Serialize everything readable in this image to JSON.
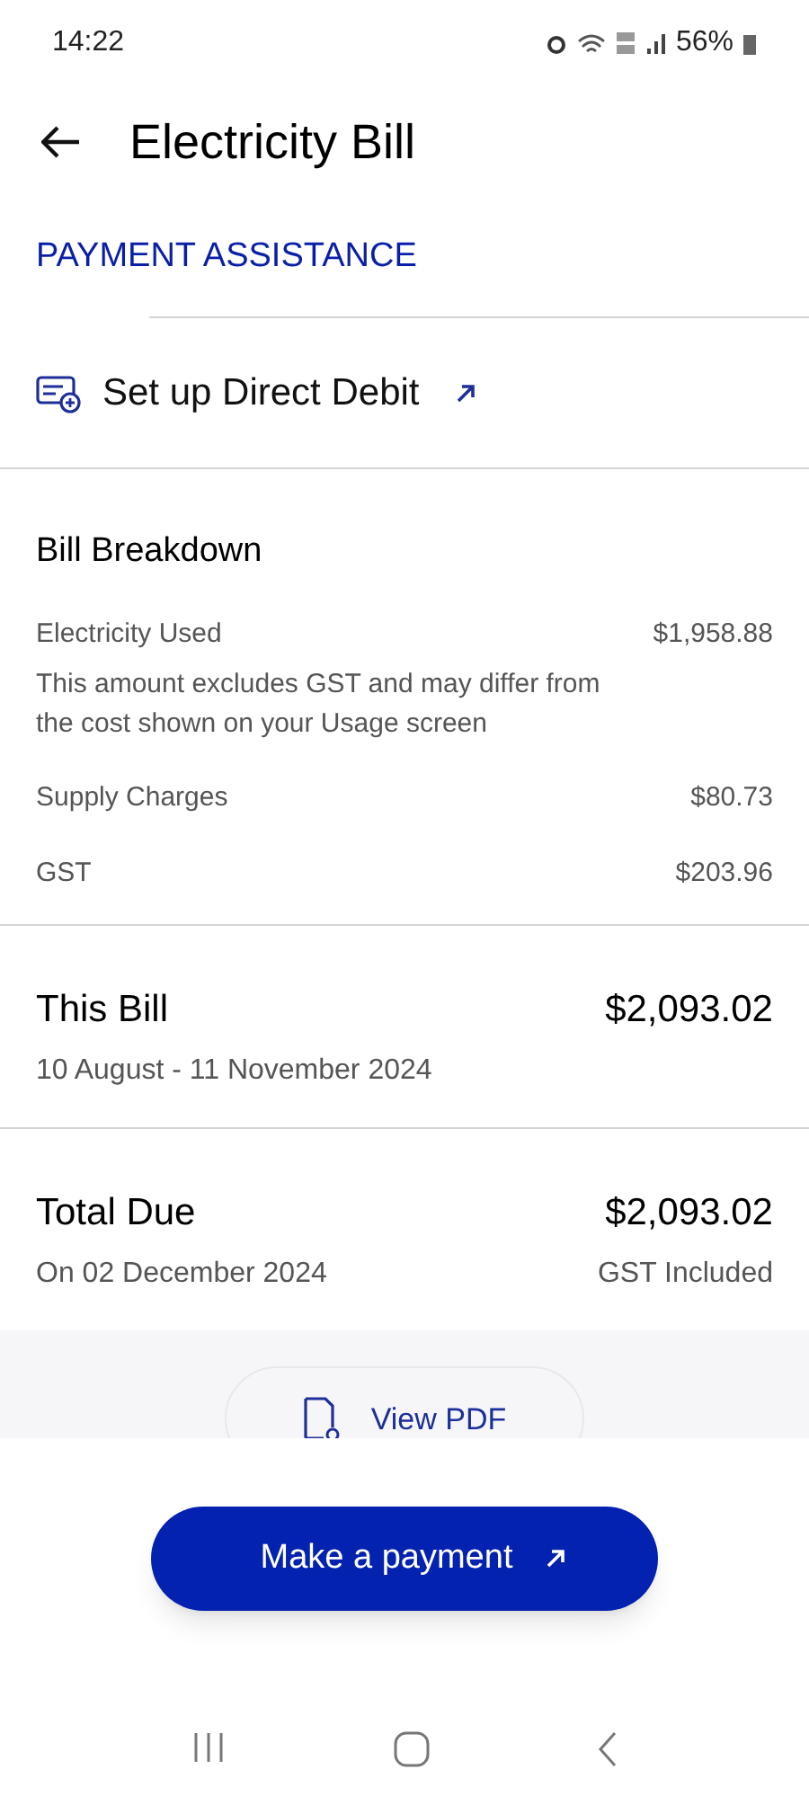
{
  "status_bar": {
    "time": "14:22",
    "battery": "56%"
  },
  "header": {
    "title": "Electricity Bill"
  },
  "payment_assistance": {
    "label": "PAYMENT ASSISTANCE"
  },
  "direct_debit": {
    "label": "Set up Direct Debit"
  },
  "bill_breakdown": {
    "title": "Bill Breakdown",
    "rows": [
      {
        "label": "Electricity Used",
        "amount": "$1,958.88",
        "note": "This amount excludes GST and may differ from the cost shown on your Usage screen"
      },
      {
        "label": "Supply Charges",
        "amount": "$80.73"
      },
      {
        "label": "GST",
        "amount": "$203.96"
      }
    ]
  },
  "this_bill": {
    "label": "This Bill",
    "amount": "$2,093.02",
    "period": "10 August - 11 November 2024"
  },
  "total_due": {
    "label": "Total Due",
    "amount": "$2,093.02",
    "due": "On 02 December 2024",
    "tax_note": "GST Included"
  },
  "view_pdf": {
    "label": "View PDF"
  },
  "payment_button": {
    "label": "Make a payment"
  }
}
